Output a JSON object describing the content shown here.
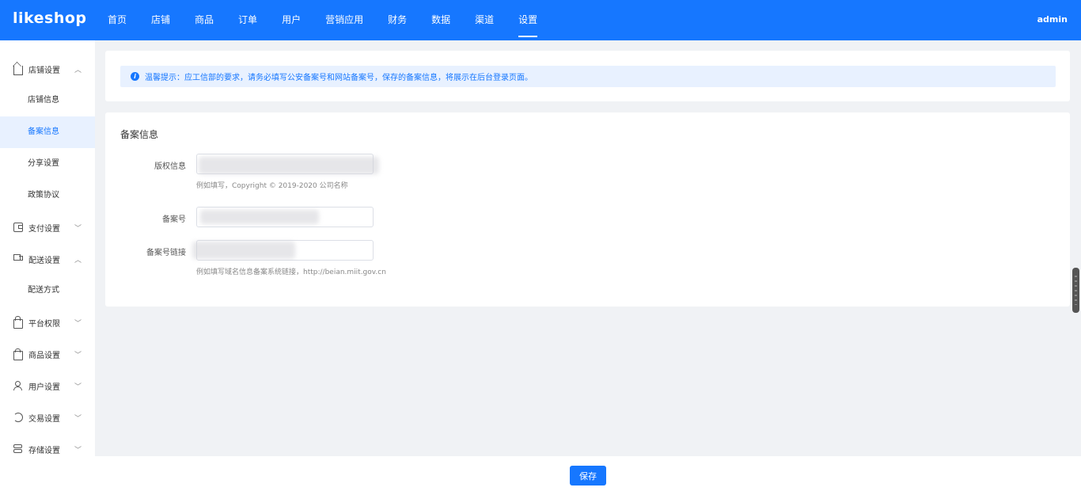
{
  "brand": {
    "logo_text": "likeshop"
  },
  "nav": {
    "items": [
      {
        "label": "首页"
      },
      {
        "label": "店铺"
      },
      {
        "label": "商品"
      },
      {
        "label": "订单"
      },
      {
        "label": "用户"
      },
      {
        "label": "营销应用"
      },
      {
        "label": "财务"
      },
      {
        "label": "数据"
      },
      {
        "label": "渠道"
      },
      {
        "label": "设置",
        "active": true
      }
    ],
    "user": "admin"
  },
  "sidebar": {
    "groups": [
      {
        "label": "店铺设置",
        "icon": "store-home-icon",
        "expanded": true,
        "children": [
          "店铺信息",
          "备案信息",
          "分享设置",
          "政策协议"
        ],
        "active_child": "备案信息"
      },
      {
        "label": "支付设置",
        "icon": "wallet-icon",
        "expanded": false
      },
      {
        "label": "配送设置",
        "icon": "truck-icon",
        "expanded": true,
        "children": [
          "配送方式"
        ]
      },
      {
        "label": "平台权限",
        "icon": "lock-icon",
        "expanded": false
      },
      {
        "label": "商品设置",
        "icon": "bag-icon",
        "expanded": false
      },
      {
        "label": "用户设置",
        "icon": "user-icon",
        "expanded": false
      },
      {
        "label": "交易设置",
        "icon": "exchange-icon",
        "expanded": false
      },
      {
        "label": "存储设置",
        "icon": "storage-icon",
        "expanded": false
      }
    ]
  },
  "tip": {
    "text": "温馨提示：应工信部的要求，请务必填写公安备案号和网站备案号，保存的备案信息，将展示在后台登录页面。"
  },
  "form": {
    "title": "备案信息",
    "fields": [
      {
        "label": "版权信息",
        "value": "",
        "hint": "例如填写，Copyright © 2019-2020 公司名称"
      },
      {
        "label": "备案号",
        "value": "",
        "hint": ""
      },
      {
        "label": "备案号链接",
        "value": "",
        "hint": "例如填写域名信息备案系统链接，http://beian.miit.gov.cn"
      }
    ]
  },
  "footer": {
    "save_label": "保存"
  },
  "colors": {
    "primary": "#1677ff",
    "active_bg": "#e8f1ff",
    "page_bg": "#f0f2f5"
  }
}
